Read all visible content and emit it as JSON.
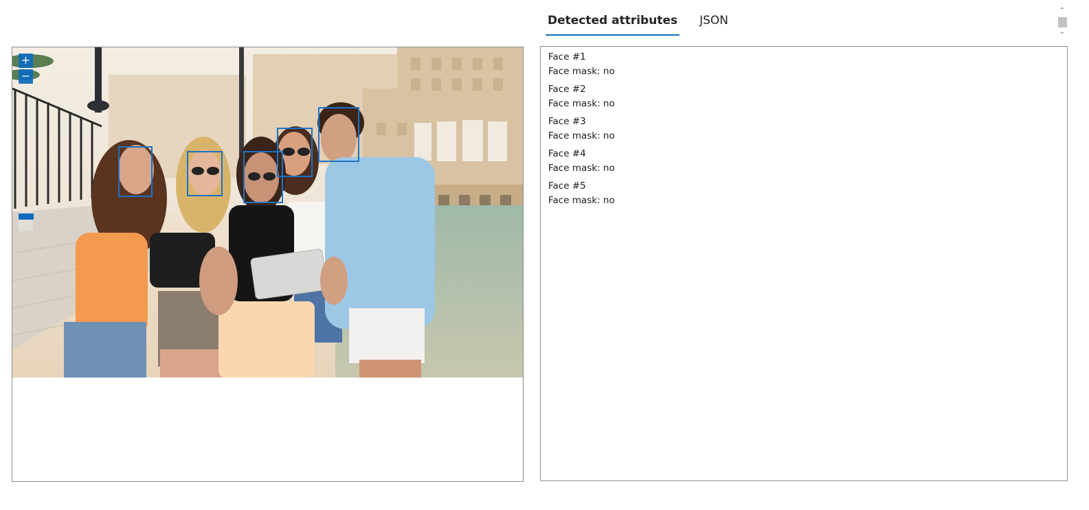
{
  "colors": {
    "accent": "#0f6cbd",
    "border": "#8a8a8a",
    "face_box": "#1a73c8"
  },
  "image_viewer": {
    "zoom_in_label": "+",
    "zoom_out_label": "−",
    "zoom_in_icon": "plus-icon",
    "zoom_out_icon": "minus-icon",
    "face_boxes": 5
  },
  "tabs": [
    {
      "label": "Detected attributes",
      "active": true
    },
    {
      "label": "JSON",
      "active": false
    }
  ],
  "scrollbar": {
    "up_icon": "chevron-up-icon",
    "down_icon": "chevron-down-icon",
    "up_glyph": "⌃",
    "down_glyph": "⌄"
  },
  "results": [
    {
      "title": "Face #1",
      "attribute": "Face mask: no"
    },
    {
      "title": "Face #2",
      "attribute": "Face mask: no"
    },
    {
      "title": "Face #3",
      "attribute": "Face mask: no"
    },
    {
      "title": "Face #4",
      "attribute": "Face mask: no"
    },
    {
      "title": "Face #5",
      "attribute": "Face mask: no"
    }
  ]
}
